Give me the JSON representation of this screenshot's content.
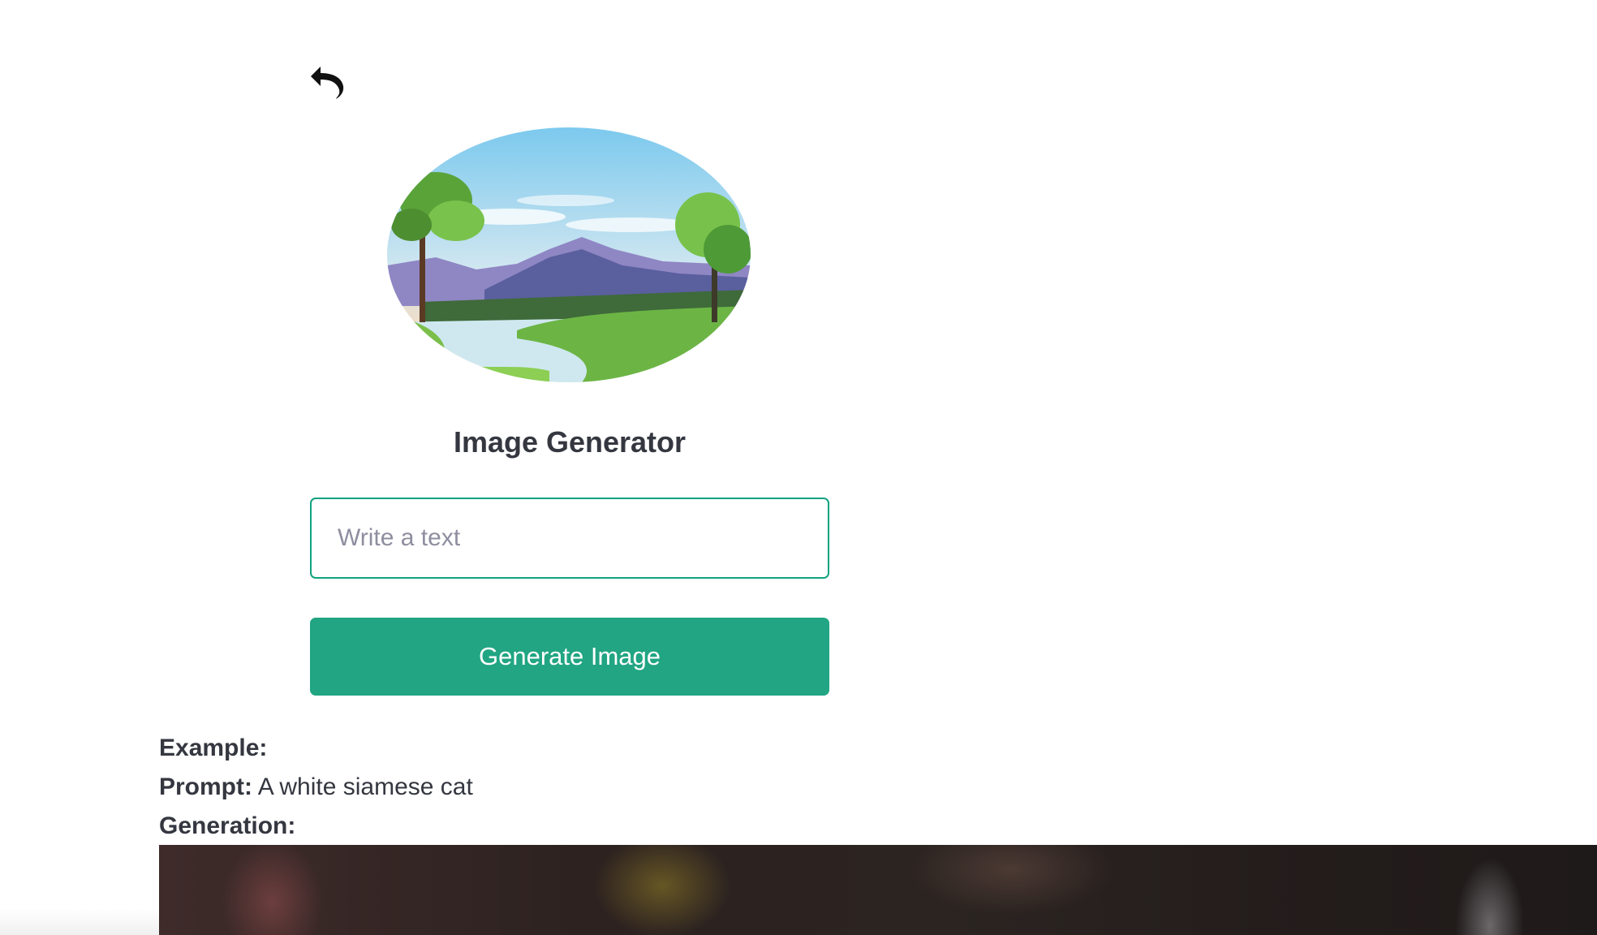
{
  "header": {
    "back_icon": "undo-arrow-icon"
  },
  "hero": {
    "image": "landscape-illustration"
  },
  "title": "Image Generator",
  "prompt_input": {
    "value": "",
    "placeholder": "Write a text"
  },
  "generate_button": {
    "label": "Generate Image"
  },
  "example": {
    "heading": "Example:",
    "prompt_label": "Prompt:",
    "prompt_text": "A white siamese cat",
    "generation_label": "Generation:"
  },
  "colors": {
    "accent": "#10a37f",
    "button_bg": "#21a583",
    "text": "#353740",
    "placeholder": "#8e8ea0"
  }
}
